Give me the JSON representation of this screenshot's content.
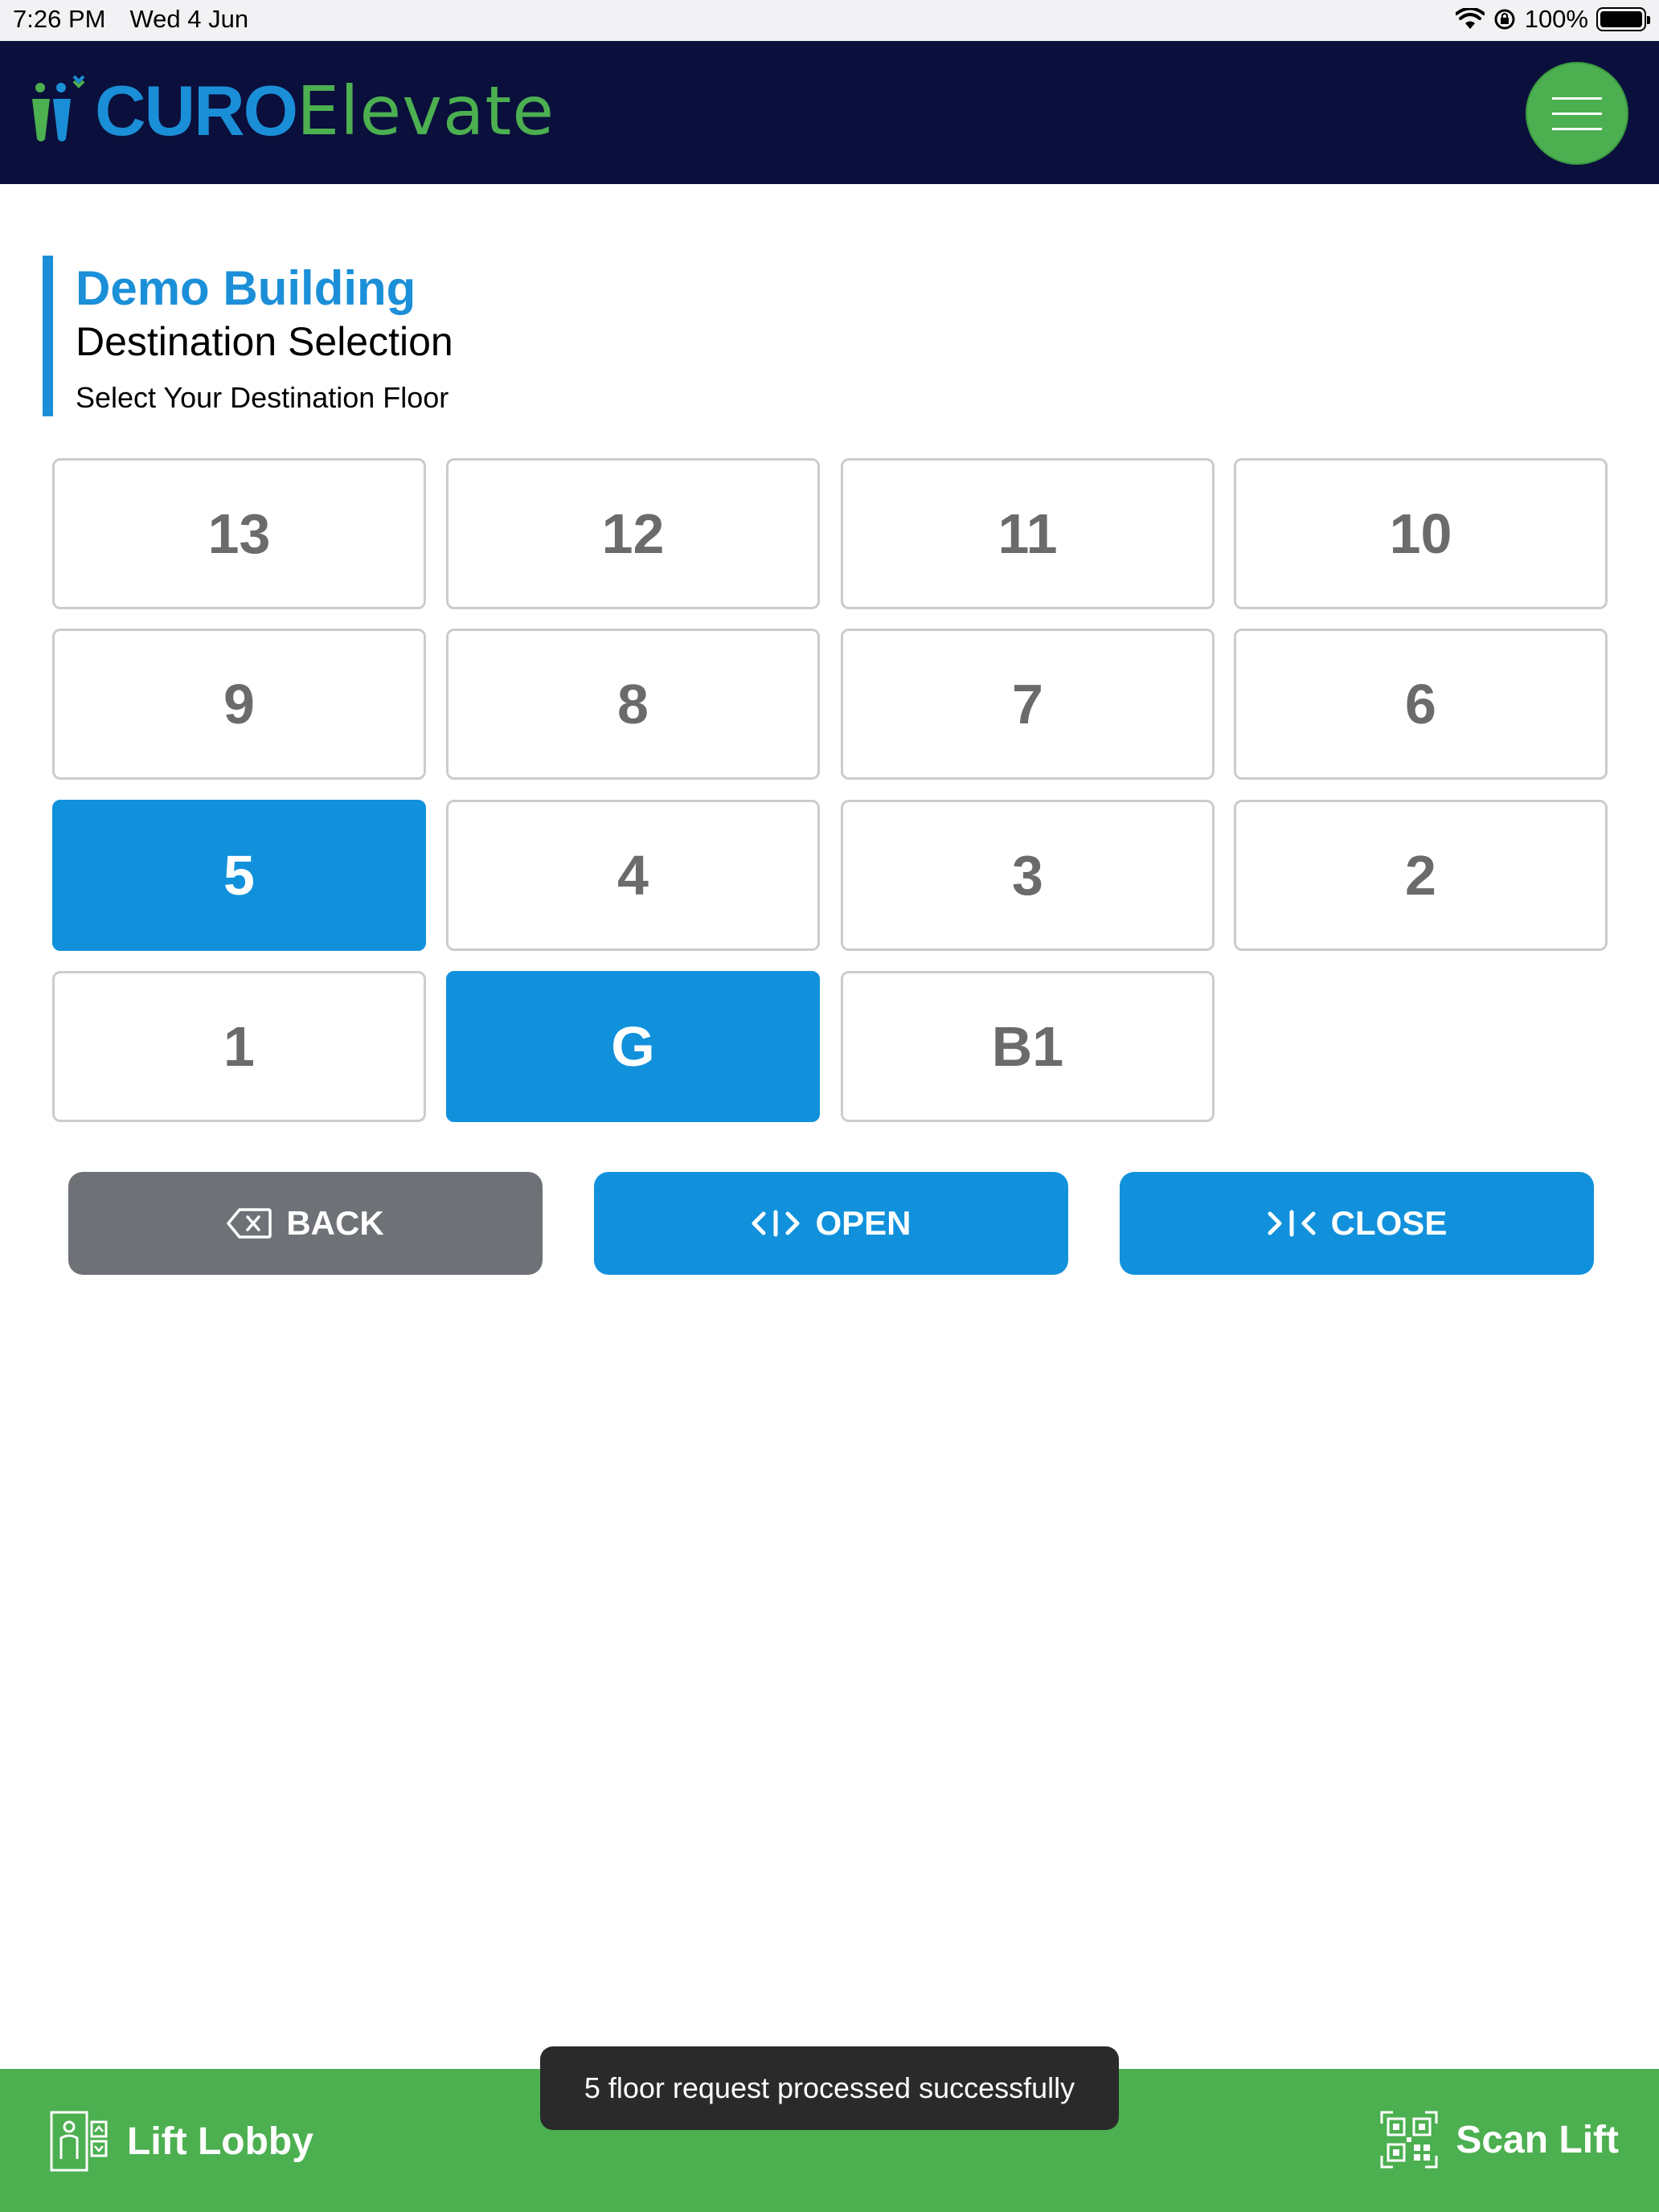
{
  "status_bar": {
    "time": "7:26 PM",
    "date": "Wed 4 Jun",
    "battery": "100%"
  },
  "header": {
    "logo_part1": "CURO",
    "logo_part2": "Elevate",
    "menu_icon": "hamburger-icon"
  },
  "title": {
    "building": "Demo Building",
    "heading": "Destination Selection",
    "subheading": "Select Your Destination Floor"
  },
  "floors": [
    {
      "label": "13",
      "selected": false
    },
    {
      "label": "12",
      "selected": false
    },
    {
      "label": "11",
      "selected": false
    },
    {
      "label": "10",
      "selected": false
    },
    {
      "label": "9",
      "selected": false
    },
    {
      "label": "8",
      "selected": false
    },
    {
      "label": "7",
      "selected": false
    },
    {
      "label": "6",
      "selected": false
    },
    {
      "label": "5",
      "selected": true
    },
    {
      "label": "4",
      "selected": false
    },
    {
      "label": "3",
      "selected": false
    },
    {
      "label": "2",
      "selected": false
    },
    {
      "label": "1",
      "selected": false
    },
    {
      "label": "G",
      "selected": true
    },
    {
      "label": "B1",
      "selected": false
    }
  ],
  "actions": {
    "back": "BACK",
    "open": "OPEN",
    "close": "CLOSE"
  },
  "toast": {
    "message": "5 floor request processed successfully"
  },
  "bottom_bar": {
    "lift_lobby": "Lift Lobby",
    "scan_lift": "Scan Lift"
  },
  "colors": {
    "primary_blue": "#1191dc",
    "header_navy": "#0a0f3c",
    "accent_green": "#4caf50",
    "back_gray": "#6e7276"
  }
}
